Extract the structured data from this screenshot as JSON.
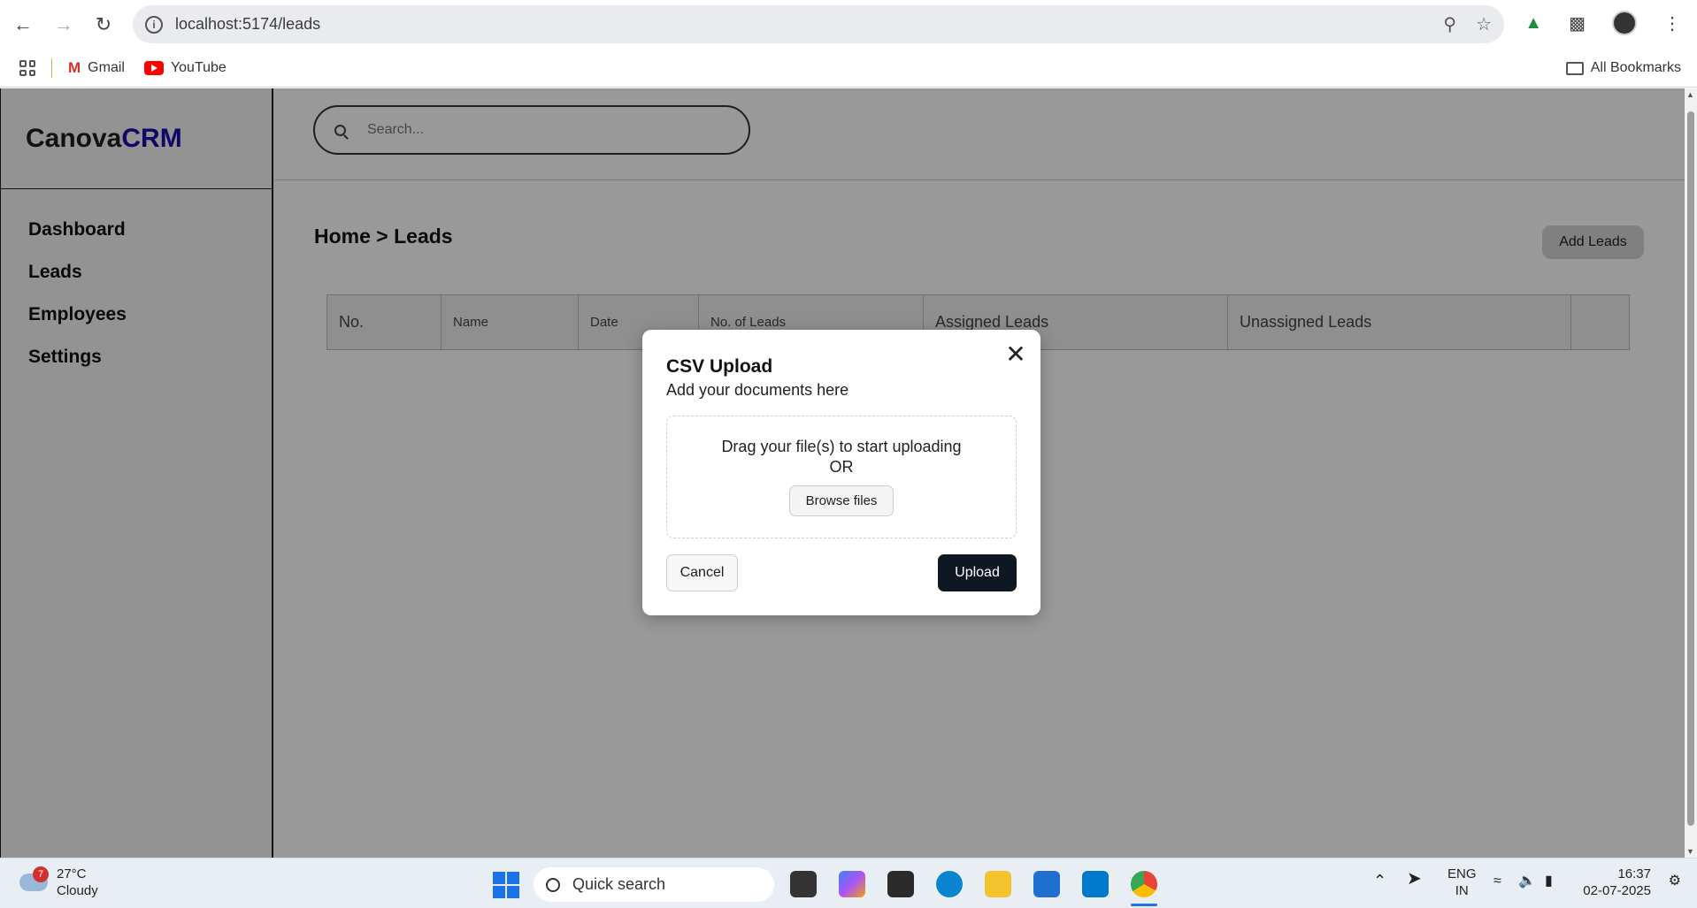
{
  "browser": {
    "url": "localhost:5174/leads",
    "bookmarks": [
      "Gmail",
      "YouTube"
    ],
    "all_bookmarks": "All Bookmarks"
  },
  "app": {
    "brand_main": "Canova",
    "brand_accent": "CRM",
    "menu": [
      "Dashboard",
      "Leads",
      "Employees",
      "Settings"
    ],
    "search_placeholder": "Search...",
    "breadcrumb": "Home > Leads",
    "add_leads_label": "Add Leads",
    "table_headers": [
      "No.",
      "Name",
      "Date",
      "No. of Leads",
      "Assigned Leads",
      "Unassigned Leads",
      ""
    ]
  },
  "modal": {
    "title": "CSV Upload",
    "subtitle": "Add your documents here",
    "drop_text": "Drag your file(s) to start uploading",
    "or_text": "OR",
    "browse_label": "Browse files",
    "cancel_label": "Cancel",
    "upload_label": "Upload"
  },
  "taskbar": {
    "weather_badge": "7",
    "temperature": "27°C",
    "condition": "Cloudy",
    "quick_search": "Quick search",
    "lang_1": "ENG",
    "lang_2": "IN",
    "time": "16:37",
    "date": "02-07-2025"
  },
  "colors": {
    "brand_accent": "#1a0dab",
    "upload_button": "#0f1723"
  }
}
